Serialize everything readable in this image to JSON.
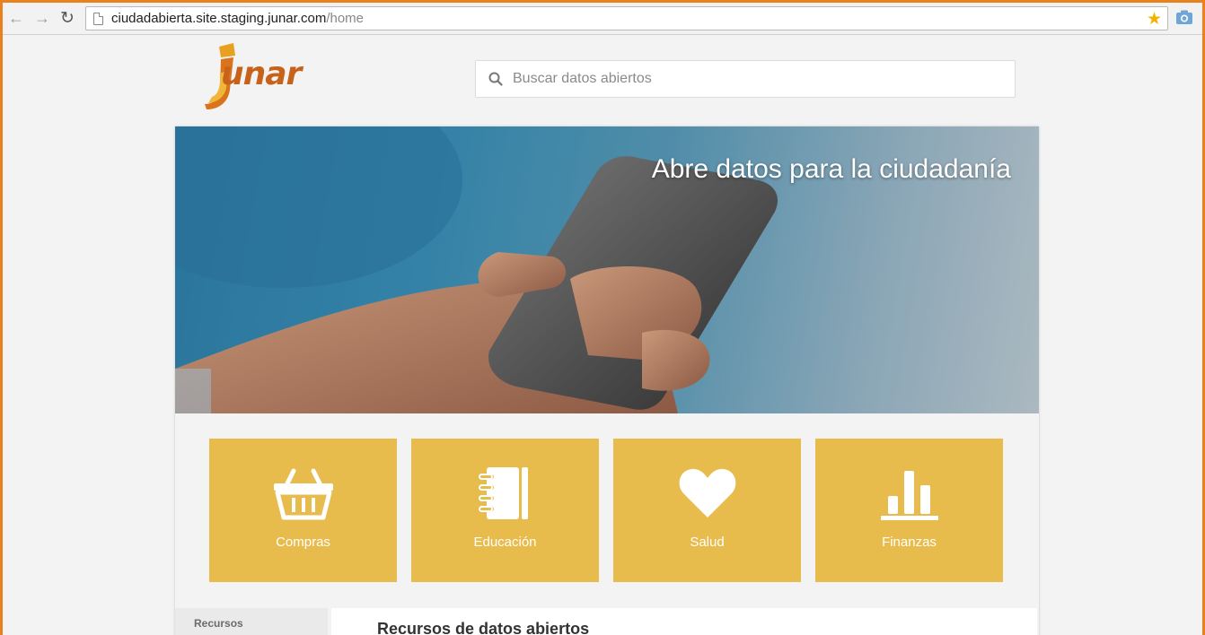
{
  "browser": {
    "url_host": "ciudadabierta.site.staging.junar.com",
    "url_path": "/home",
    "icons": [
      "back-arrow-icon",
      "forward-arrow-icon",
      "reload-icon",
      "page-icon",
      "bookmark-star-icon",
      "camera-icon"
    ]
  },
  "header": {
    "logo_text": "unar",
    "search_placeholder": "Buscar datos abiertos"
  },
  "hero": {
    "title": "Abre datos para la ciudadanía"
  },
  "categories": [
    {
      "label": "Compras",
      "icon": "basket-icon"
    },
    {
      "label": "Educación",
      "icon": "notebook-icon"
    },
    {
      "label": "Salud",
      "icon": "heart-icon"
    },
    {
      "label": "Finanzas",
      "icon": "bar-chart-icon"
    }
  ],
  "sidebar": {
    "title": "Recursos"
  },
  "content": {
    "title": "Recursos de datos abiertos"
  },
  "colors": {
    "accent": "#e8821e",
    "tile": "#e8bc4c",
    "logo": "#c8621a"
  }
}
